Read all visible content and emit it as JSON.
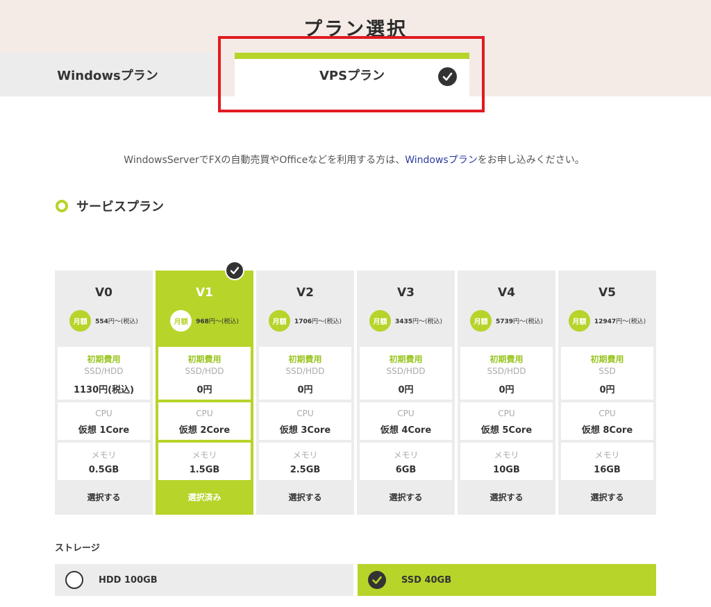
{
  "page": {
    "title": "プラン選択"
  },
  "tabs": [
    {
      "label": "Windowsプラン",
      "selected": false
    },
    {
      "label": "VPSプラン",
      "selected": true
    }
  ],
  "notice": {
    "before": "WindowsServerでFXの自動売買やOfficeなどを利用する方は、",
    "link": "Windowsプラン",
    "after": "をお申し込みください。"
  },
  "section": {
    "title": "サービスプラン"
  },
  "plan_labels": {
    "badge": "月額",
    "initial_fee": "初期費用",
    "cpu": "CPU",
    "memory": "メモリ"
  },
  "plans": [
    {
      "name": "V0",
      "price": "554",
      "price_suffix": "円～(税込)",
      "disk": "SSD/HDD",
      "initial": "1130円(税込)",
      "cpu": "仮想 1Core",
      "memory": "0.5GB",
      "action": "選択する",
      "selected": false
    },
    {
      "name": "V1",
      "price": "968",
      "price_suffix": "円～(税込)",
      "disk": "SSD/HDD",
      "initial": "0円",
      "cpu": "仮想 2Core",
      "memory": "1.5GB",
      "action": "選択済み",
      "selected": true
    },
    {
      "name": "V2",
      "price": "1706",
      "price_suffix": "円～(税込)",
      "disk": "SSD/HDD",
      "initial": "0円",
      "cpu": "仮想 3Core",
      "memory": "2.5GB",
      "action": "選択する",
      "selected": false
    },
    {
      "name": "V3",
      "price": "3435",
      "price_suffix": "円～(税込)",
      "disk": "SSD/HDD",
      "initial": "0円",
      "cpu": "仮想 4Core",
      "memory": "6GB",
      "action": "選択する",
      "selected": false
    },
    {
      "name": "V4",
      "price": "5739",
      "price_suffix": "円～(税込)",
      "disk": "SSD/HDD",
      "initial": "0円",
      "cpu": "仮想 5Core",
      "memory": "10GB",
      "action": "選択する",
      "selected": false
    },
    {
      "name": "V5",
      "price": "12947",
      "price_suffix": "円～(税込)",
      "disk": "SSD",
      "initial": "0円",
      "cpu": "仮想 8Core",
      "memory": "16GB",
      "action": "選択する",
      "selected": false
    }
  ],
  "storage": {
    "label": "ストレージ",
    "options": [
      {
        "label": "HDD 100GB",
        "selected": false
      },
      {
        "label": "SSD 40GB",
        "selected": true
      }
    ]
  },
  "colors": {
    "accent": "#b6d42a",
    "header_bg": "#f4ebe6",
    "highlight": "#e01a22",
    "dark": "#333333"
  },
  "icons": [
    "check-circle-icon",
    "ring-icon",
    "radio-empty-icon"
  ]
}
